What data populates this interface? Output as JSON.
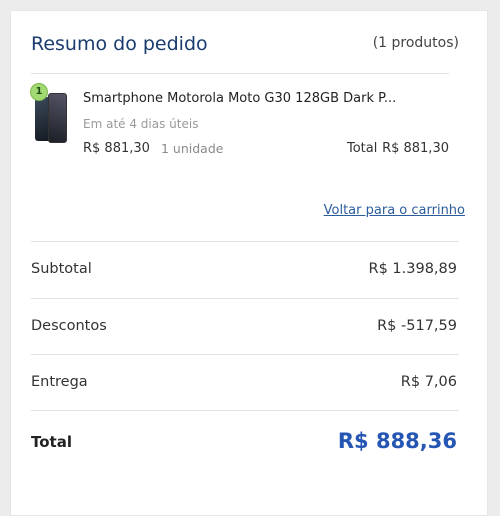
{
  "summary": {
    "title": "Resumo do pedido",
    "count_text": "(1 produtos)"
  },
  "item": {
    "badge": "1",
    "name": "Smartphone Motorola Moto G30 128GB Dark P...",
    "delivery": "Em até 4 dias úteis",
    "unit_price": "R$ 881,30",
    "quantity": "1 unidade",
    "total_label": "Total",
    "total_value": "R$ 881,30",
    "thumbnail_icon": "phone-product-image"
  },
  "back_link": "Voltar para o carrinho",
  "rows": {
    "subtotal": {
      "label": "Subtotal",
      "value": "R$ 1.398,89"
    },
    "discounts": {
      "label": "Descontos",
      "value": "R$ -517,59"
    },
    "shipping": {
      "label": "Entrega",
      "value": "R$ 7,06"
    }
  },
  "grand_total": {
    "label": "Total",
    "value": "R$ 888,36"
  },
  "colors": {
    "title": "#1a3c6e",
    "link": "#2b5c9c",
    "grand_total": "#2656b3",
    "badge": "#a3d973"
  }
}
